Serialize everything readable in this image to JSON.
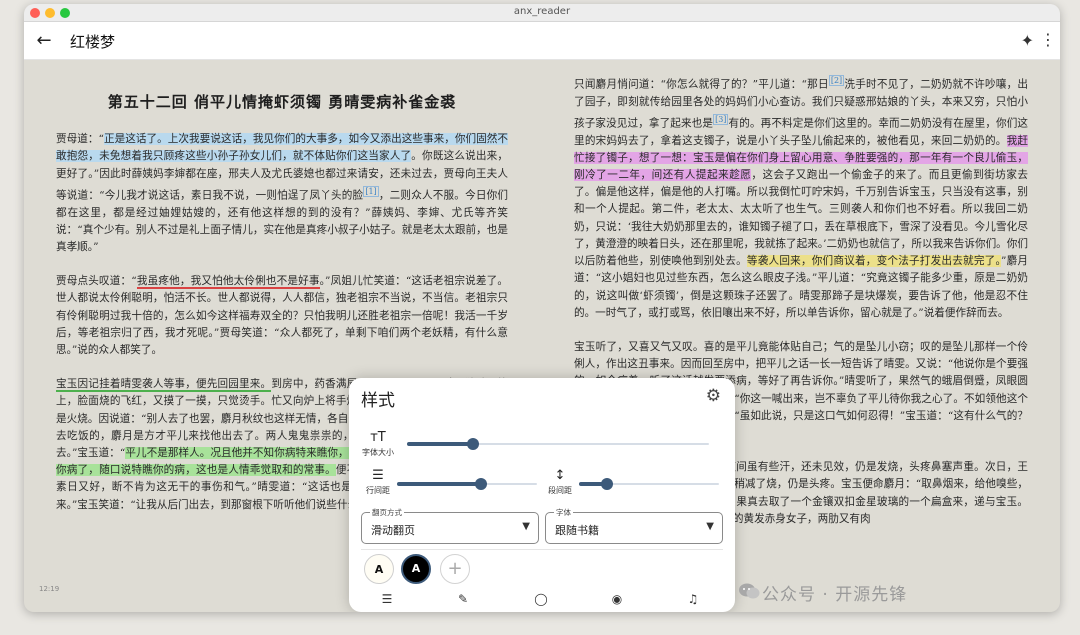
{
  "window": {
    "title": "anx_reader"
  },
  "appbar": {
    "back_icon": "←",
    "title": "红楼梦",
    "ai_icon": "✦",
    "more_icon": "⋮"
  },
  "reader": {
    "chapter_title": "第五十二回 俏平儿情掩虾须镯 勇晴雯病补雀金裘",
    "time": "12:19",
    "left": {
      "p1": {
        "a": "贾母道：“",
        "hl": "正是这话了。上次我要说这话，我见你们的大事多，如今又添出这些事来，你们固然不敢抱怨，未免想着我只顾疼这些小孙子孙女儿们，就不体贴你们这当家人了",
        "b": "。你既这么说出来，更好了。”因此时薛姨妈李婶都在座，邢夫人及尤氏婆媳也都过来请安，还未过去，贾母向王夫人等说道：“今儿我才说这话，素日我不说，一则怕逞了凤丫头的脸",
        "note": "[1]",
        "c": "，二则众人不服。今日你们都在这里，都是经过妯娌姑嫂的，还有他这样想的到的没有？”薛姨妈、李婶、尤氏等齐笑说：“真个少有。别人不过是礼上面子情儿，实在他是真疼小叔子小姑子。就是老太太跟前，也是真孝顺。”"
      },
      "p2": {
        "a": "贾母点头叹道：“",
        "ul": "我虽疼他，我又怕他太伶俐也不是好事",
        "b": "。”凤姐儿忙笑道：“这话老祖宗说差了。世人都说太伶俐聪明，怕活不长。世人都说得，人人都信，独老祖宗不当说，不当信。老祖宗只有伶俐聪明过我十倍的，怎么如今这样福寿双全的？只怕我明儿还胜老祖宗一倍呢！我活一千岁后，等老祖宗归了西，我才死呢。”贾母笑道：“众人都死了，单剩下咱们两个老妖精，有什么意思。”说的众人都笑了。"
      },
      "p3": {
        "ul": "宝玉因记挂着晴雯袭人等事，便先回园里来。",
        "a": "到房中，药香满屋，一人不见，只见晴雯独卧于炕上，脸面烧的飞红，又摸了一摸，只觉烫手。忙又向炉上将手烘暖，伸进被去摸了一摸身上，也是火烧。因说道：“别人去了也罢，麝月秋纹也这样无情，各自去了？”晴雯道：“秋纹是我撵了他去吃饭的，麝月是方才平儿来找他出去了。两人鬼鬼祟祟的，不知说什么。必是说我病了不出去。”宝玉道：“",
        "hl": "平儿不是那样人。况且他并不知你病特来瞧你，想来一定是找麝月来说话，偶然见你病了，随口说特瞧你的病，这也是人情乖觉取和的常事。",
        "b": "便不出去，有不是，与他何干？你们素日又好，断不肯为这无干的事伤和气。”晴雯道：“这话也是，只是疑他为什么忽然又瞒起我来。”宝玉笑道：“让我从后门出去，到那窗根下听听他们说些什么，来告诉你。”说着，果"
      }
    },
    "right": {
      "p1": {
        "a": "只闻麝月悄问道：“你怎么就得了的？”平儿道：“那日",
        "note": "[2]",
        "b": "洗手时不见了，二奶奶就不许吵嚷，出了园子，即刻就传给园里各处的妈妈们小心查访。我们只疑惑邢姑娘的丫头，本来又穷，只怕小孩子家没见过，拿了起来也是",
        "note2": "[3]",
        "c": "有的。再不料定是你们这里的。幸而二奶奶没有在屋里，你们这里的宋妈妈去了，拿着这支镯子，说是小丫头子坠儿偷起来的，被他看见，来回二奶奶的。",
        "hl": "我赶忙接了镯子，想了一想：宝玉是偏在你们身上留心用意、争胜要强的，那一年有一个良儿偷玉，刚冷了一二年，间还有人提起来趁愿",
        "d": "，这会子又跑出一个偷金子的来了。而且更偷到街坊家去了。偏是他这样，偏是他的人打嘴。所以我倒忙叮咛宋妈，千万别告诉宝玉，只当没有这事，别和一个人提起。第二件，老太太、太太听了也生气。三则袭人和你们也不好看。所以我回二奶奶，只说：‘我往大奶奶那里去的，谁知镯子褪了口，丢在草根底下，雪深了没看见。今儿雪化尽了，黄澄澄的映着日头，还在那里呢，我就拣了起来。’二奶奶也就信了，所以我来告诉你们。你们以后防着他些，别使唤他到别处去。",
        "hl2": "等袭人回来，你们商议着，变个法子打发出去就完了。",
        "e": "”麝月道：“这小娼妇也见过些东西，怎么这么眼皮子浅。”平儿道：“究竟这镯子能多少重，原是二奶奶的，说这叫做‘虾须镯’，倒是这颗珠子还罢了。晴雯那蹄子是块爆炭，要告诉了他，他是忍不住的。一时气了，或打或骂，依旧嚷出来不好，所以单告诉你，留心就是了。”说着便作辞而去。"
      },
      "p2": {
        "a": "宝玉听了，又喜又气又叹。喜的是平儿竟能体贴自己；气的是坠儿小窃；叹的是坠儿那样一个伶俐人，作出这丑事来。因而回至房中，把平儿之话一长一短告诉了晴雯。又说：“他说你是个要强的，如今病着，听了这话越发要添病，等好了再告诉你。”晴雯听了，果然气的蛾眉倒蹙，凤眼圆睁，即时就唤坠儿。宝玉忙劝道：“你这一喊出来，岂不辜负了平儿待你我之心了。不如领他这个情，过后打发他就完了。”晴雯道：“虽如此说，只是这口气如何忍得！”宝玉道：“这有什么气的？你只养病就是了。”"
      },
      "p3": {
        "a": "晴雯服了药，至晚间又服二和，夜间虽有些汗，还未见效，仍是发烧，头疼鼻塞声重。次日，王太医又来诊视，另加减汤剂。虽然稍减了烧，仍是头疼。宝玉便命麝月：“取鼻烟来，给他嗅些，痛打几个嚏喷，就通了关窍。”麝月果真去取了一个金镶双扣金星玻璃的一个扁盒来，递与宝玉。宝玉便揭翻盒扇，里面有西洋珐琅的黄发赤身女子，两肋又有肉"
      }
    }
  },
  "style_panel": {
    "title": "样式",
    "settings_icon": "gear-icon",
    "font_size": {
      "icon": "тT",
      "label": "字体大小",
      "value": 0.22
    },
    "line_spacing": {
      "icon": "☰",
      "label": "行间距",
      "value": 0.6
    },
    "paragraph_spacing": {
      "icon": "↕",
      "label": "段间距",
      "value": 0.2
    },
    "page_turn": {
      "label": "翻页方式",
      "value": "滑动翻页"
    },
    "font": {
      "label": "字体",
      "value": "跟随书籍"
    },
    "themes": {
      "light_label": "A",
      "dark_label": "A",
      "add_label": "+"
    },
    "bottom_nav": [
      "toc-icon",
      "pen-icon",
      "circle-icon",
      "palette-icon",
      "headphones-icon"
    ]
  },
  "watermark": {
    "text": "公众号 · 开源先锋"
  },
  "colors": {
    "accent": "#3d5a7a",
    "page_bg": "#dedcd4",
    "hl_blue": "#b9d9ee",
    "hl_purple": "#e3a5e6",
    "hl_yellow": "#ece08a",
    "hl_green": "#a8e29a"
  }
}
